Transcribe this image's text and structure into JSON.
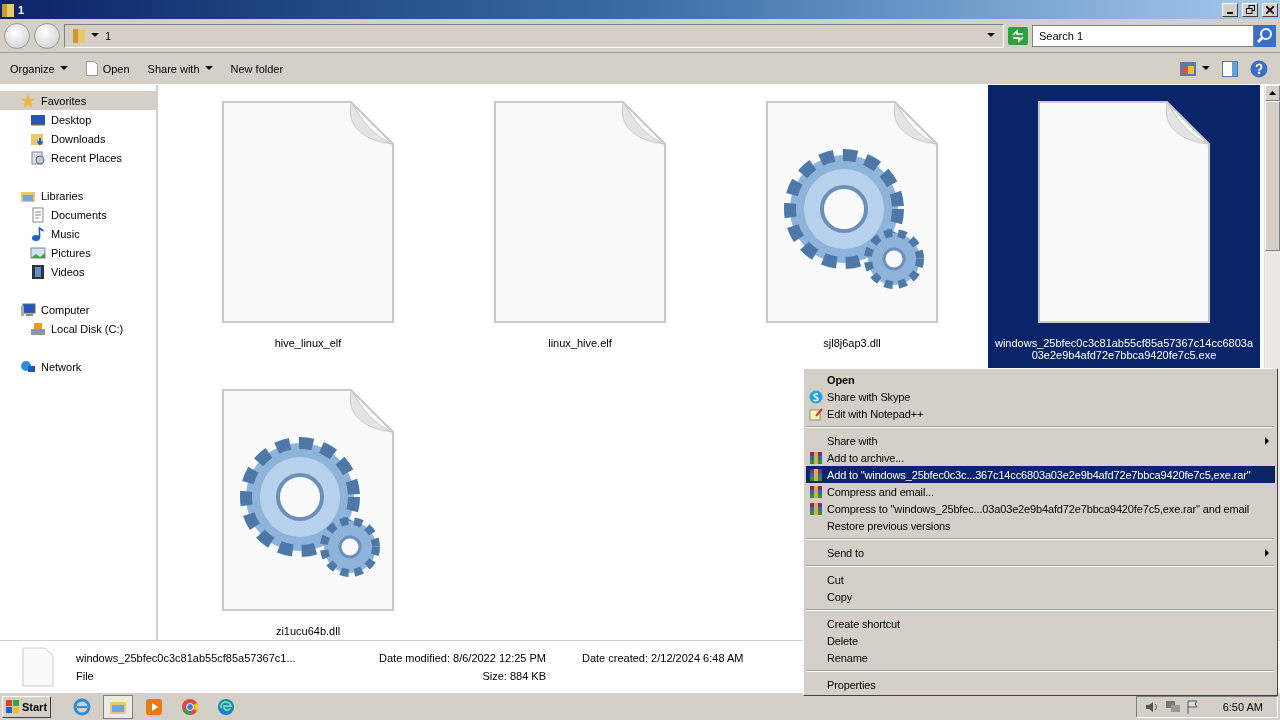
{
  "window": {
    "title": "1"
  },
  "address": {
    "path": "1",
    "search_placeholder": "Search 1"
  },
  "toolbar": [
    {
      "label": "Organize",
      "dropdown": true
    },
    {
      "label": "Open",
      "dropdown": false
    },
    {
      "label": "Share with",
      "dropdown": true
    },
    {
      "label": "New folder",
      "dropdown": false
    }
  ],
  "sidebar": {
    "groups": [
      {
        "label": "Favorites",
        "selected": true,
        "children": [
          {
            "label": "Desktop"
          },
          {
            "label": "Downloads"
          },
          {
            "label": "Recent Places"
          }
        ]
      },
      {
        "label": "Libraries",
        "selected": false,
        "children": [
          {
            "label": "Documents"
          },
          {
            "label": "Music"
          },
          {
            "label": "Pictures"
          },
          {
            "label": "Videos"
          }
        ]
      },
      {
        "label": "Computer",
        "selected": false,
        "children": [
          {
            "label": "Local Disk (C:)"
          }
        ]
      },
      {
        "label": "Network",
        "selected": false
      }
    ]
  },
  "files": [
    {
      "name": "hive_linux_elf",
      "kind": "blank",
      "selected": false
    },
    {
      "name": "linux_hive.elf",
      "kind": "blank",
      "selected": false
    },
    {
      "name": "sjl8j6ap3.dll",
      "kind": "gears",
      "selected": false
    },
    {
      "name": "windows_25bfec0c3c81ab55cf85a57367c14cc6803a03e2e9b4afd72e7bbca9420fe7c5.exe",
      "kind": "blank",
      "selected": true
    },
    {
      "name": "zi1ucu64b.dll",
      "kind": "gears",
      "selected": false
    }
  ],
  "context_menu": [
    {
      "kind": "plain",
      "label": "Open",
      "default": true,
      "submenu": false,
      "selected": false
    },
    {
      "kind": "skype",
      "label": "Share with Skype",
      "default": false,
      "submenu": false,
      "selected": false
    },
    {
      "kind": "notepad",
      "label": "Edit with Notepad++",
      "default": false,
      "submenu": false,
      "selected": false
    },
    {
      "kind": "separator"
    },
    {
      "kind": "plain",
      "label": "Share with",
      "default": false,
      "submenu": true,
      "selected": false
    },
    {
      "kind": "archive",
      "label": "Add to archive...",
      "default": false,
      "submenu": false,
      "selected": false
    },
    {
      "kind": "archive",
      "label": "Add to \"windows_25bfec0c3c...367c14cc6803a03e2e9b4afd72e7bbca9420fe7c5,exe.rar\"",
      "default": false,
      "submenu": false,
      "selected": true
    },
    {
      "kind": "archive",
      "label": "Compress and email...",
      "default": false,
      "submenu": false,
      "selected": false
    },
    {
      "kind": "archive",
      "label": "Compress to \"windows_25bfec...03a03e2e9b4afd72e7bbca9420fe7c5,exe.rar\" and email",
      "default": false,
      "submenu": false,
      "selected": false
    },
    {
      "kind": "plain",
      "label": "Restore previous versions",
      "default": false,
      "submenu": false,
      "selected": false
    },
    {
      "kind": "separator"
    },
    {
      "kind": "plain",
      "label": "Send to",
      "default": false,
      "submenu": true,
      "selected": false
    },
    {
      "kind": "separator"
    },
    {
      "kind": "plain",
      "label": "Cut",
      "default": false,
      "submenu": false,
      "selected": false
    },
    {
      "kind": "plain",
      "label": "Copy",
      "default": false,
      "submenu": false,
      "selected": false
    },
    {
      "kind": "separator"
    },
    {
      "kind": "plain",
      "label": "Create shortcut",
      "default": false,
      "submenu": false,
      "selected": false
    },
    {
      "kind": "plain",
      "label": "Delete",
      "default": false,
      "submenu": false,
      "selected": false
    },
    {
      "kind": "plain",
      "label": "Rename",
      "default": false,
      "submenu": false,
      "selected": false
    },
    {
      "kind": "separator"
    },
    {
      "kind": "plain",
      "label": "Properties",
      "default": false,
      "submenu": false,
      "selected": false
    }
  ],
  "details": {
    "name": "windows_25bfec0c3c81ab55cf85a57367c1...",
    "type": "File",
    "modified_label": "Date modified:",
    "modified": "8/6/2022 12:25 PM",
    "size_label": "Size:",
    "size": "884 KB",
    "created_label": "Date created:",
    "created": "2/12/2024 6:48 AM"
  },
  "taskbar": {
    "start": "Start",
    "apps": [
      {
        "selected": false
      },
      {
        "selected": true
      },
      {
        "selected": false
      },
      {
        "selected": false
      },
      {
        "selected": false
      }
    ],
    "clock": "6:50 AM"
  }
}
